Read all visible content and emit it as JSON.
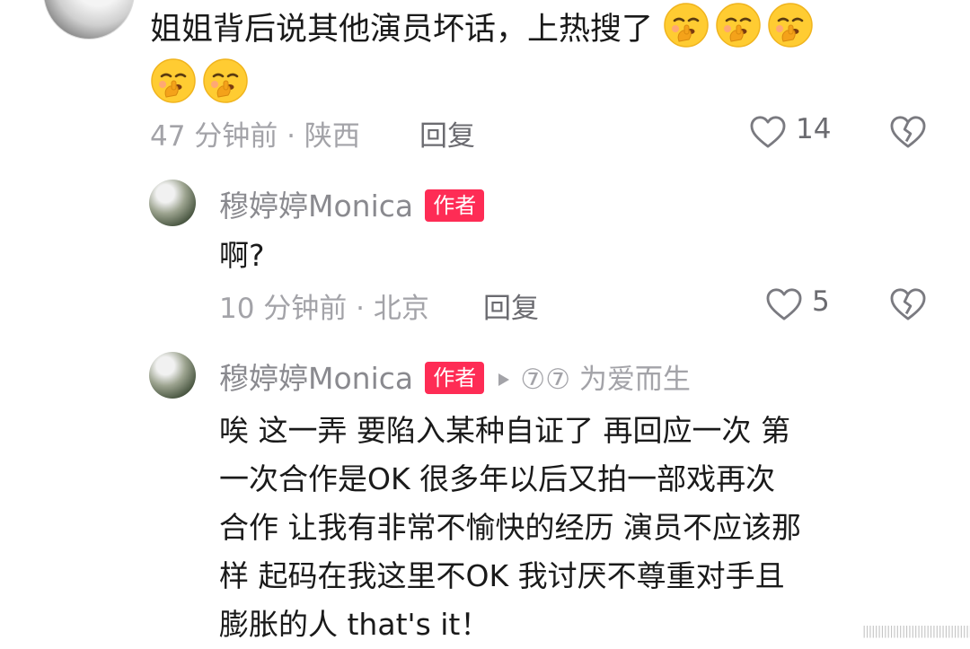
{
  "main_comment": {
    "text": "姐姐背后说其他演员坏话，上热搜了",
    "time_location": "47 分钟前 · 陕西",
    "reply_label": "回复",
    "likes": "14"
  },
  "reply1": {
    "author": "穆婷婷Monica",
    "badge": "作者",
    "text": "啊?",
    "time_location": "10 分钟前 · 北京",
    "reply_label": "回复",
    "likes": "5"
  },
  "reply2": {
    "author": "穆婷婷Monica",
    "badge": "作者",
    "reply_to": "⑦⑦ 为爱而生",
    "lines": [
      "唉 这一弄 要陷入某种自证了 再回应一次 第",
      "一次合作是OK 很多年以后又拍一部戏再次",
      "合作 让我有非常不愉快的经历 演员不应该那",
      "样 起码在我这里不OK 我讨厌不尊重对手且",
      "膨胀的人 that's it！"
    ]
  },
  "icons": {
    "emoji": "shushing-face-emoji",
    "like": "heart-outline-icon",
    "dislike": "broken-heart-icon",
    "reply_arrow": "triangle-right-icon"
  },
  "watermark": "||||||||||||||||||||||||||||||||||||"
}
